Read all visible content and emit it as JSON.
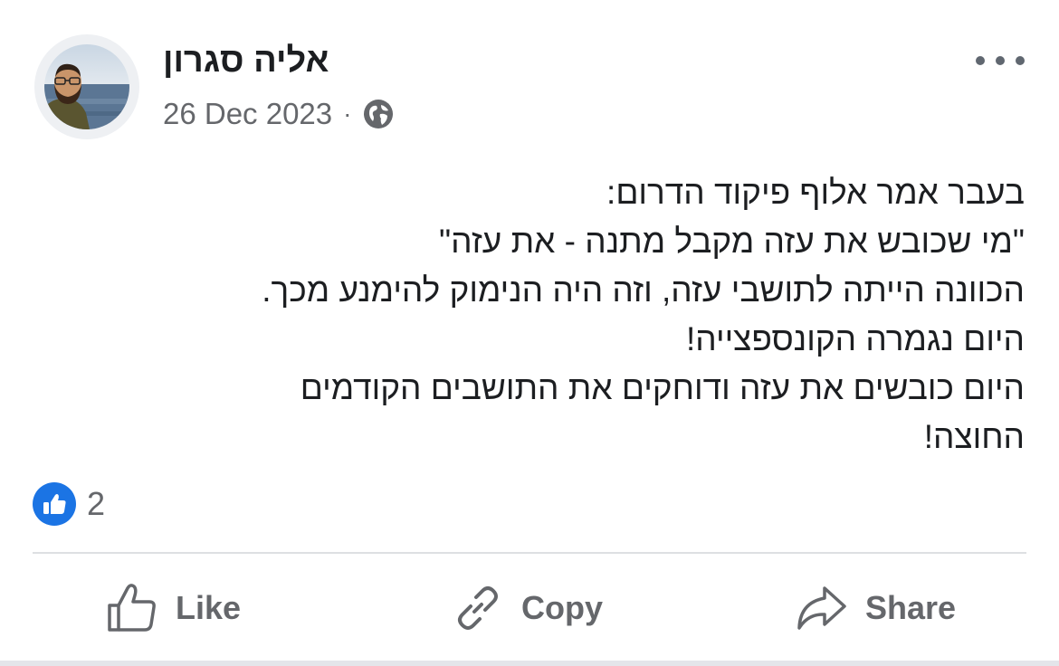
{
  "post": {
    "author_name": "אליה סגרון",
    "date": "26 Dec 2023",
    "separator": "·",
    "privacy_icon": "globe-icon",
    "menu_icon": "more-options-icon",
    "text_lines": [
      "בעבר אמר אלוף פיקוד הדרום:",
      "\"מי שכובש את עזה מקבל מתנה - את עזה\"",
      "הכוונה הייתה לתושבי עזה, וזה היה הנימוק להימנע מכך.",
      "היום נגמרה הקונספצייה!",
      "היום כובשים את עזה ודוחקים את התושבים הקודמים",
      "החוצה!"
    ]
  },
  "reactions": {
    "icon": "thumbs-up-icon",
    "count": "2"
  },
  "actions": {
    "like_label": "Like",
    "copy_label": "Copy",
    "share_label": "Share"
  },
  "colors": {
    "accent": "#1b74e4",
    "text": "#1c1e21",
    "secondary_text": "#65676b",
    "divider": "#dddfe2"
  }
}
